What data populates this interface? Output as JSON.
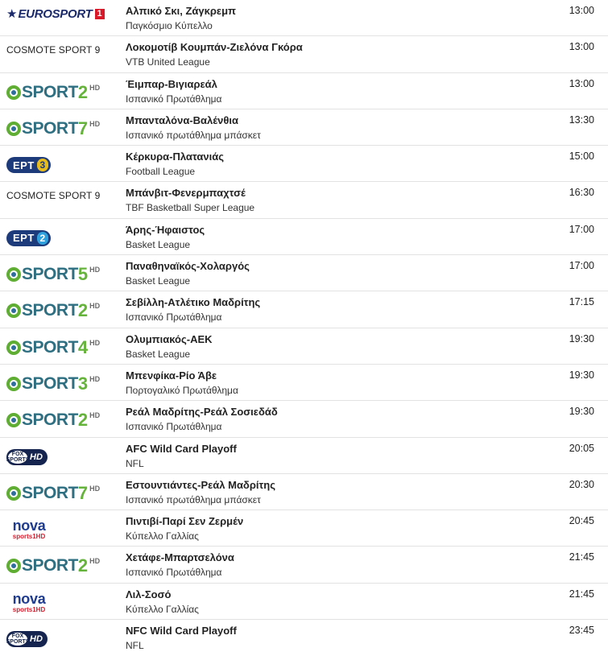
{
  "schedule": [
    {
      "channel": {
        "type": "eurosport",
        "text": "EUROSPORT",
        "num": "1",
        "icon": "eurosport-logo"
      },
      "title": "Αλπικό Σκι, Ζάγκρεμπ",
      "competition": "Παγκόσμιο Κύπελλο",
      "time": "13:00"
    },
    {
      "channel": {
        "type": "text",
        "text": "COSMOTE SPORT 9"
      },
      "title": "Λοκομοτίβ Κουμπάν-Ζιελόνα Γκόρα",
      "competition": "VTB United League",
      "time": "13:00"
    },
    {
      "channel": {
        "type": "sport",
        "text": "SPORT",
        "num": "2",
        "hd": "HD",
        "icon": "sport2-hd-logo"
      },
      "title": "Έιμπαρ-Βιγιαρεάλ",
      "competition": "Ισπανικό Πρωτάθλημα",
      "time": "13:00"
    },
    {
      "channel": {
        "type": "sport",
        "text": "SPORT",
        "num": "7",
        "hd": "HD",
        "icon": "sport7-hd-logo"
      },
      "title": "Μπανταλόνα-Βαλένθια",
      "competition": "Ισπανικό πρωτάθλημα μπάσκετ",
      "time": "13:30"
    },
    {
      "channel": {
        "type": "ert",
        "text": "ΕΡΤ",
        "num": "3",
        "icon": "ert3-logo"
      },
      "title": "Κέρκυρα-Πλατανιάς",
      "competition": "Football League",
      "time": "15:00"
    },
    {
      "channel": {
        "type": "text",
        "text": "COSMOTE SPORT 9"
      },
      "title": "Μπάνβιτ-Φενερμπαχτσέ",
      "competition": "TBF Basketball Super League",
      "time": "16:30"
    },
    {
      "channel": {
        "type": "ert",
        "text": "ΕΡΤ",
        "num": "2",
        "icon": "ert2-logo"
      },
      "title": "Άρης-Ήφαιστος",
      "competition": "Basket League",
      "time": "17:00"
    },
    {
      "channel": {
        "type": "sport",
        "text": "SPORT",
        "num": "5",
        "hd": "HD",
        "icon": "sport5-hd-logo"
      },
      "title": "Παναθηναϊκός-Χολαργός",
      "competition": "Basket League",
      "time": "17:00"
    },
    {
      "channel": {
        "type": "sport",
        "text": "SPORT",
        "num": "2",
        "hd": "HD",
        "icon": "sport2-hd-logo"
      },
      "title": "Σεβίλλη-Ατλέτικο Μαδρίτης",
      "competition": "Ισπανικό Πρωτάθλημα",
      "time": "17:15"
    },
    {
      "channel": {
        "type": "sport",
        "text": "SPORT",
        "num": "4",
        "hd": "HD",
        "icon": "sport4-hd-logo"
      },
      "title": "Ολυμπιακός-ΑΕΚ",
      "competition": "Basket League",
      "time": "19:30"
    },
    {
      "channel": {
        "type": "sport",
        "text": "SPORT",
        "num": "3",
        "hd": "HD",
        "icon": "sport3-hd-logo"
      },
      "title": "Μπενφίκα-Ρίο Άβε",
      "competition": "Πορτογαλικό Πρωτάθλημα",
      "time": "19:30"
    },
    {
      "channel": {
        "type": "sport",
        "text": "SPORT",
        "num": "2",
        "hd": "HD",
        "icon": "sport2-hd-logo"
      },
      "title": "Ρεάλ Μαδρίτης-Ρεάλ Σοσιεδάδ",
      "competition": "Ισπανικό Πρωτάθλημα",
      "time": "19:30"
    },
    {
      "channel": {
        "type": "fox",
        "text": "FOX SPORTS",
        "hd": "HD",
        "icon": "fox-sports-hd-logo"
      },
      "title": "AFC Wild Card Playoff",
      "competition": "NFL",
      "time": "20:05"
    },
    {
      "channel": {
        "type": "sport",
        "text": "SPORT",
        "num": "7",
        "hd": "HD",
        "icon": "sport7-hd-logo"
      },
      "title": "Εστουντιάντες-Ρεάλ Μαδρίτης",
      "competition": "Ισπανικό πρωτάθλημα μπάσκετ",
      "time": "20:30"
    },
    {
      "channel": {
        "type": "nova",
        "text": "nova",
        "sub": "sports1HD",
        "icon": "nova-sports1-hd-logo"
      },
      "title": "Πιντιβί-Παρί Σεν Ζερμέν",
      "competition": "Κύπελλο Γαλλίας",
      "time": "20:45"
    },
    {
      "channel": {
        "type": "sport",
        "text": "SPORT",
        "num": "2",
        "hd": "HD",
        "icon": "sport2-hd-logo"
      },
      "title": "Χετάφε-Μπαρτσελόνα",
      "competition": "Ισπανικό Πρωτάθλημα",
      "time": "21:45"
    },
    {
      "channel": {
        "type": "nova",
        "text": "nova",
        "sub": "sports1HD",
        "icon": "nova-sports1-hd-logo"
      },
      "title": "Λιλ-Σοσό",
      "competition": "Κύπελλο Γαλλίας",
      "time": "21:45"
    },
    {
      "channel": {
        "type": "fox",
        "text": "FOX SPORTS",
        "hd": "HD",
        "icon": "fox-sports-hd-logo"
      },
      "title": "NFC Wild Card Playoff",
      "competition": "NFL",
      "time": "23:45"
    }
  ]
}
